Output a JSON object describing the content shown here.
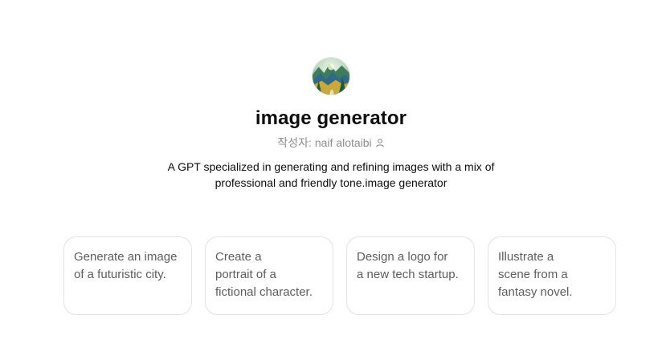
{
  "gpt": {
    "name": "image generator",
    "author_prefix": "작성자:",
    "author_name": "naif alotaibi",
    "description": "A GPT specialized in generating and refining images with a mix of professional and friendly tone.image generator",
    "avatar_icon": "landscape-avatar-icon",
    "author_icon": "person-icon"
  },
  "conversation_starters": [
    {
      "label": "Generate an image\nof a futuristic city."
    },
    {
      "label": "Create a\nportrait of a\nfictional character."
    },
    {
      "label": "Design a logo for\na new tech startup."
    },
    {
      "label": "Illustrate a\nscene from a\nfantasy novel."
    }
  ],
  "colors": {
    "title": "#0d0d0d",
    "muted": "#8e8e8e",
    "starter_text": "#5d5d5d",
    "starter_border": "#e3e3e3"
  }
}
